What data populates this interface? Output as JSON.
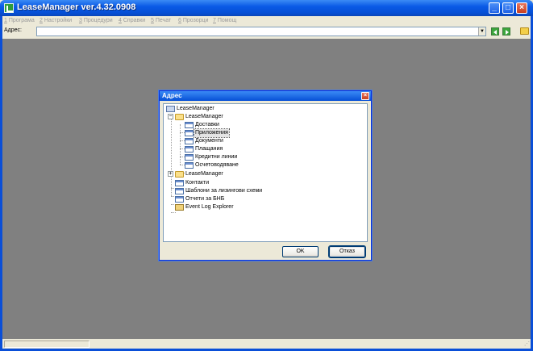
{
  "window": {
    "title": "LeaseManager ver.4.32.0908"
  },
  "menu": [
    {
      "acc": "1",
      "rest": " Програма"
    },
    {
      "acc": "2",
      "rest": " Настройки"
    },
    {
      "acc": "3",
      "rest": " Процедури"
    },
    {
      "acc": "4",
      "rest": " Справки"
    },
    {
      "acc": "5",
      "rest": " Печат"
    },
    {
      "acc": "6",
      "rest": " Прозорци"
    },
    {
      "acc": "7",
      "rest": " Помощ"
    }
  ],
  "address": {
    "label": "Адрес:",
    "value": ""
  },
  "dialog": {
    "title": "Адрес",
    "tree": {
      "root": "LeaseManager",
      "group1": {
        "label": "LeaseManager",
        "children": [
          "Доставки",
          "Приложения",
          "Документи",
          "Плащания",
          "Кредитни линии",
          "Осчетоводяване"
        ]
      },
      "group2": {
        "label": "LeaseManager"
      },
      "items": [
        "Контакти",
        "Шаблони за лизингови схеми",
        "Отчети за БНБ",
        "Event Log Explorer"
      ]
    },
    "ok_label": "OK",
    "cancel_label": "Отказ"
  },
  "colors": {
    "titlebar": "#0a5ae6",
    "workspace": "#808080",
    "dialog_bg": "#ece9d8"
  }
}
